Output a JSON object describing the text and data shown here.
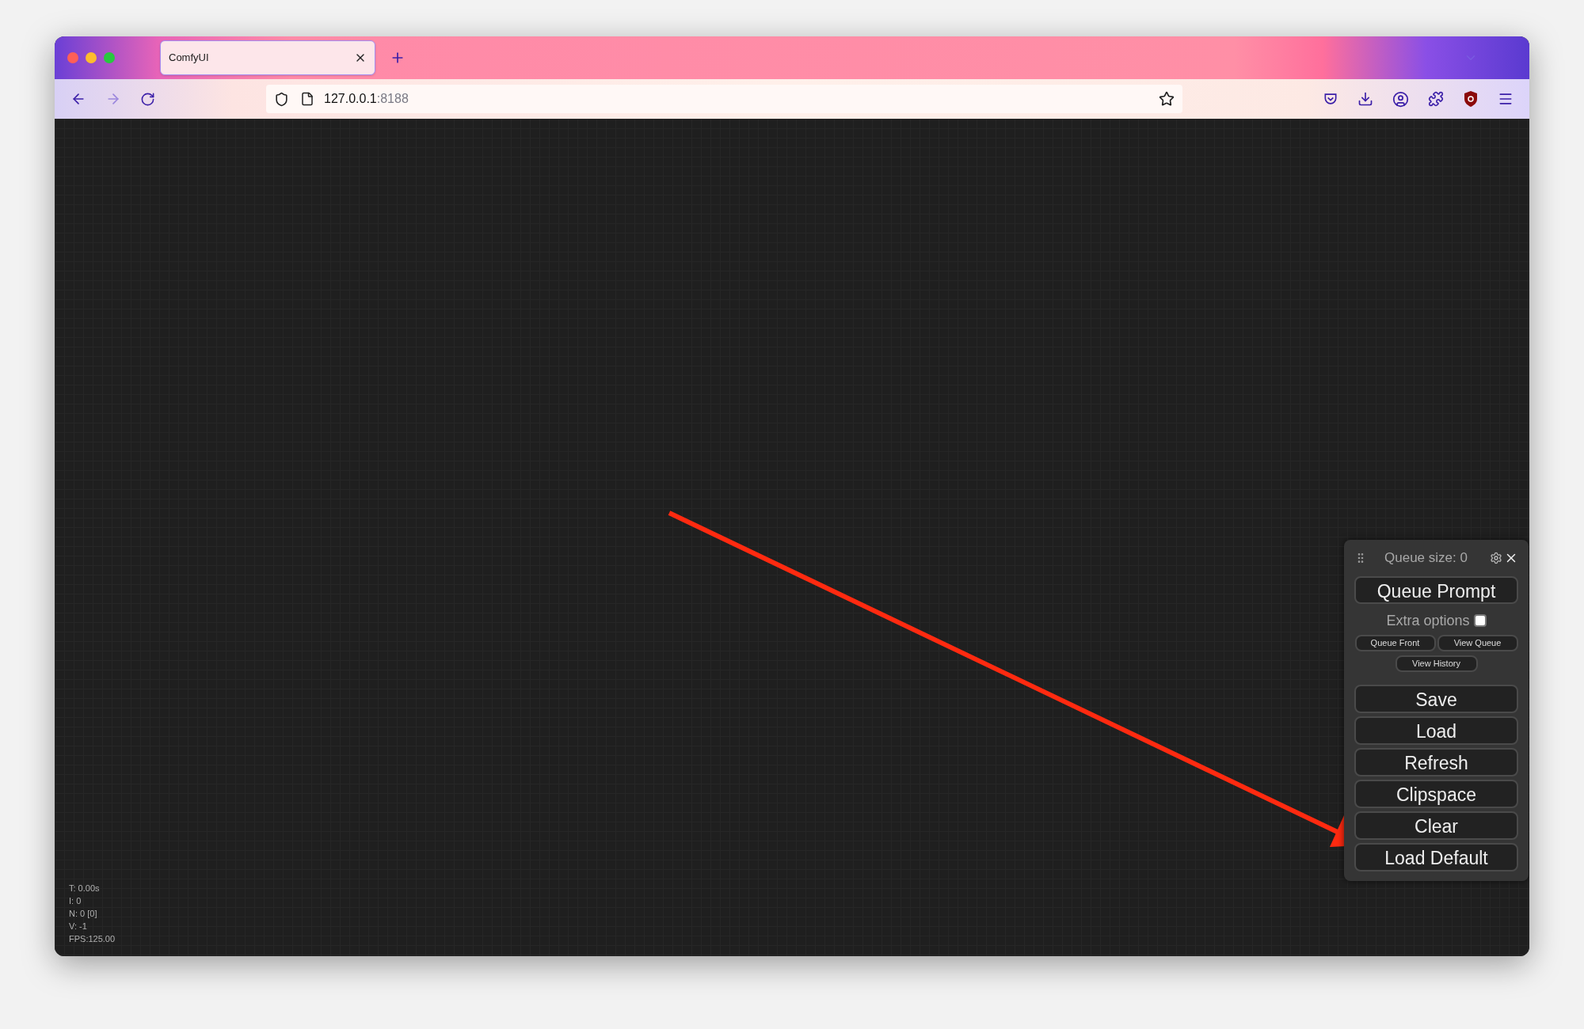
{
  "browser": {
    "tab": {
      "title": "ComfyUI",
      "selected": true
    },
    "address": {
      "host": "127.0.0.1",
      "port": ":8188"
    }
  },
  "stats": [
    "T: 0.00s",
    "I: 0",
    "N: 0 [0]",
    "V: -1",
    "FPS:125.00"
  ],
  "menu": {
    "queue_size": "Queue size: 0",
    "queue_button": "Queue Prompt",
    "extra_options": {
      "label": "Extra options",
      "checked": false
    },
    "small_buttons": [
      "Queue Front",
      "View Queue",
      "View History"
    ],
    "buttons": [
      "Save",
      "Load",
      "Refresh",
      "Clipspace",
      "Clear",
      "Load Default"
    ]
  }
}
